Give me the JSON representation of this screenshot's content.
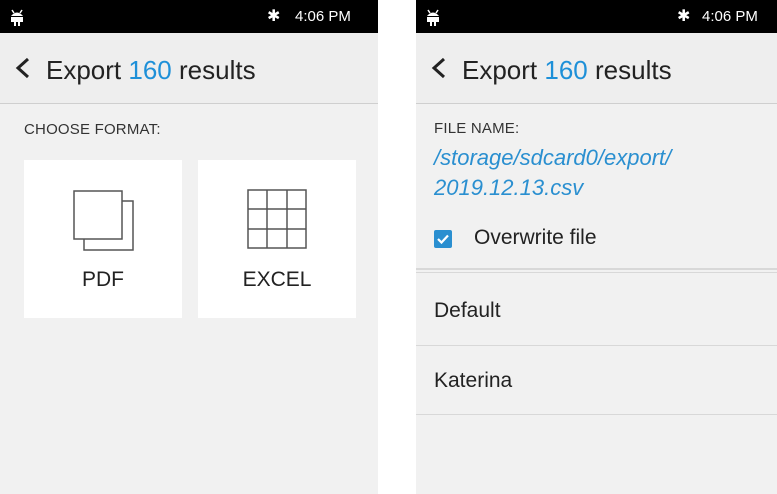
{
  "status_bar": {
    "time": "4:06 PM",
    "bluetooth_icon": "bluetooth-icon",
    "notification_icon": "android-icon"
  },
  "left_screen": {
    "header": {
      "prefix": "Export",
      "count": "160",
      "suffix": "results",
      "back_icon": "chevron-left-icon"
    },
    "section_label": "CHOOSE FORMAT:",
    "formats": [
      {
        "label": "PDF",
        "icon": "pages-icon"
      },
      {
        "label": "EXCEL",
        "icon": "grid-icon"
      }
    ]
  },
  "right_screen": {
    "header": {
      "prefix": "Export",
      "count": "160",
      "suffix": "results",
      "back_icon": "chevron-left-icon"
    },
    "file_name_label": "FILE NAME:",
    "file_path_line1": "/storage/sdcard0/export/",
    "file_path_line2": "2019.12.13.csv",
    "overwrite": {
      "label": "Overwrite file",
      "checked": true
    },
    "list_items": [
      "Default",
      "Katerina"
    ]
  },
  "colors": {
    "accent": "#2a8fd0",
    "status_bar": "#000000",
    "background": "#f1f1f1"
  }
}
